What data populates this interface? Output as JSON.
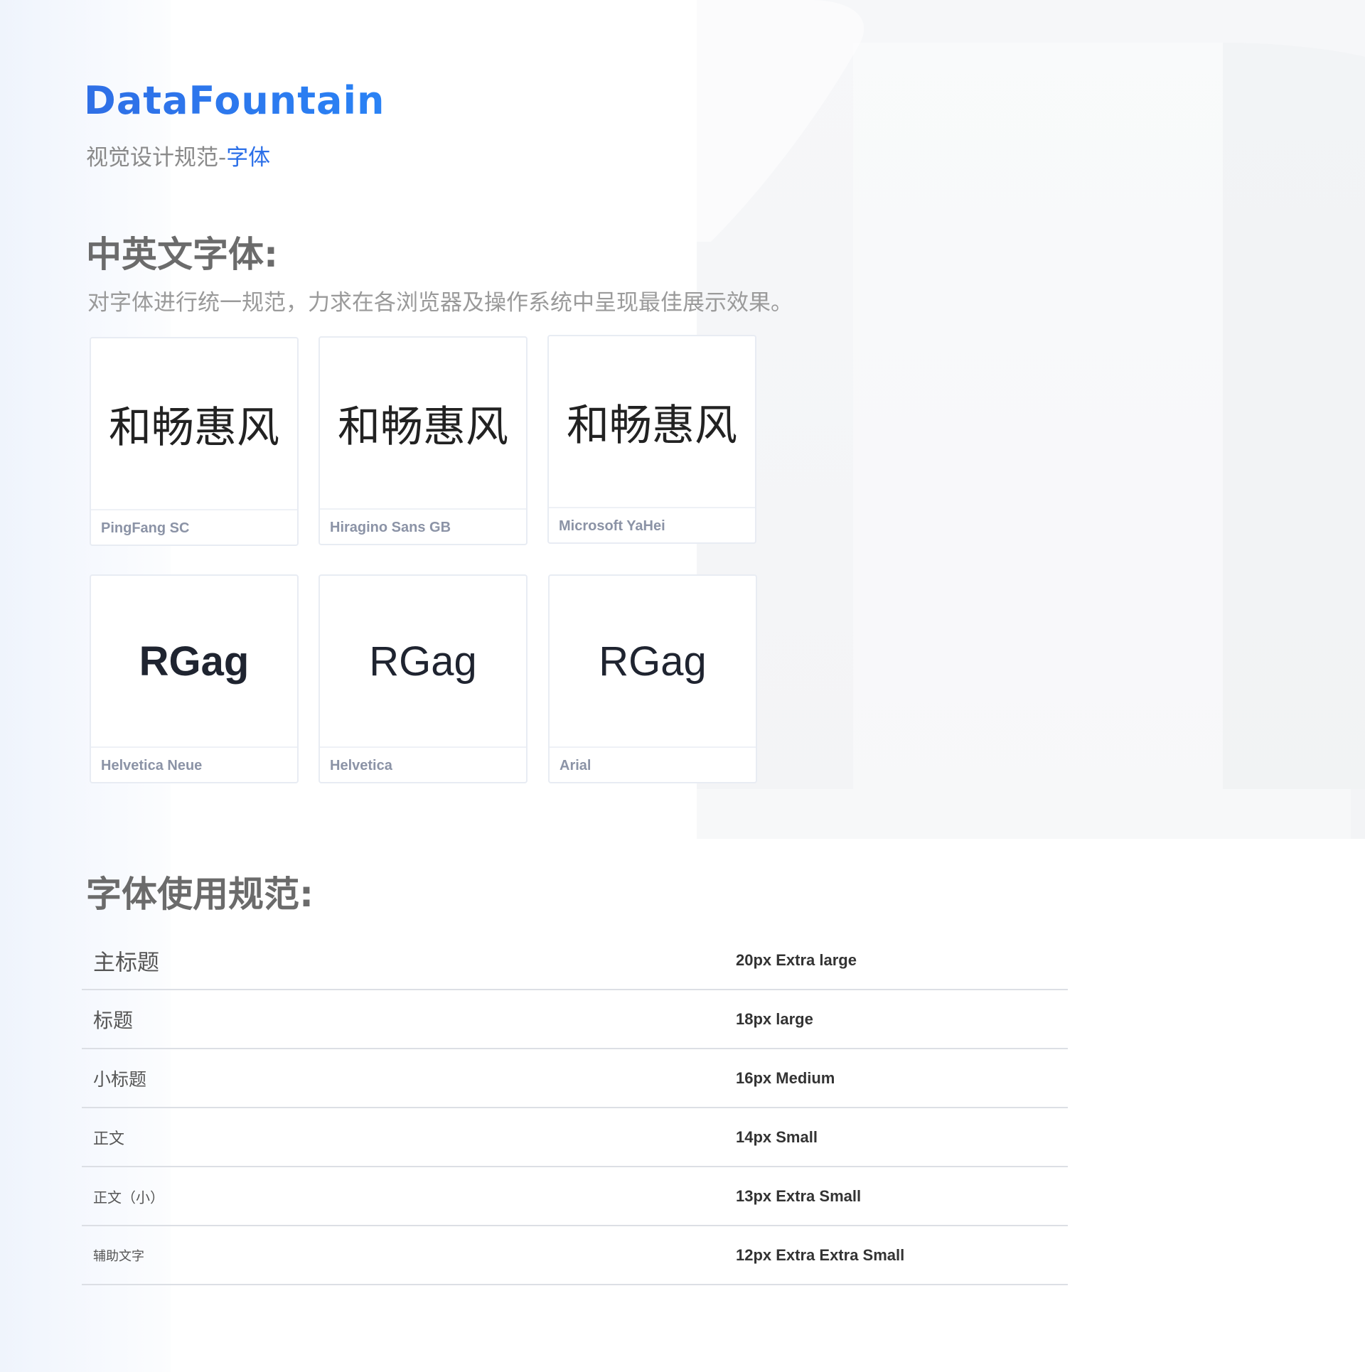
{
  "brand": {
    "logo_text": "DataFountain",
    "accent_color": "#2b6fe8"
  },
  "header": {
    "subtitle_prefix": "视觉设计规范-",
    "subtitle_highlight": "字体"
  },
  "fonts_section": {
    "title": "中英文字体:",
    "description": "对字体进行统一规范，力求在各浏览器及操作系统中呈现最佳展示效果。",
    "cards": [
      {
        "sample": "和畅惠风",
        "font_name": "PingFang SC"
      },
      {
        "sample": "和畅惠风",
        "font_name": "Hiragino Sans GB"
      },
      {
        "sample": "和畅惠风",
        "font_name": "Microsoft YaHei"
      },
      {
        "sample": "RGag",
        "font_name": "Helvetica Neue"
      },
      {
        "sample": "RGag",
        "font_name": "Helvetica"
      },
      {
        "sample": "RGag",
        "font_name": "Arial"
      }
    ]
  },
  "usage_section": {
    "title": "字体使用规范:",
    "rows": [
      {
        "label": "主标题",
        "size": "20px Extra large"
      },
      {
        "label": "标题",
        "size": "18px large"
      },
      {
        "label": "小标题",
        "size": "16px Medium"
      },
      {
        "label": "正文",
        "size": "14px Small"
      },
      {
        "label": "正文（小）",
        "size": "13px Extra Small"
      },
      {
        "label": "辅助文字",
        "size": "12px Extra Extra Small"
      }
    ]
  }
}
